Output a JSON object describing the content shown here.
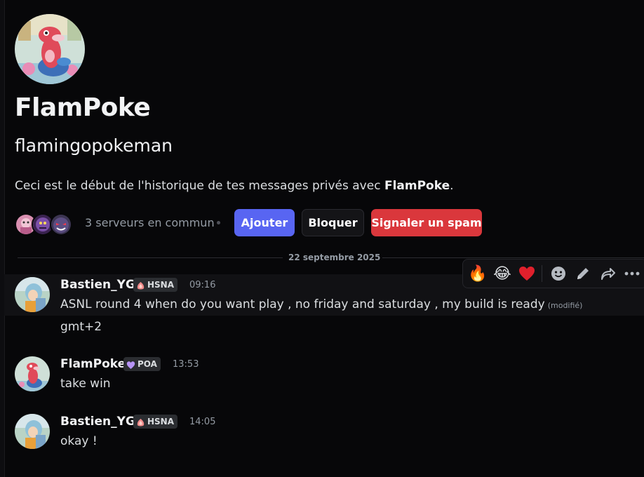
{
  "profile": {
    "display_name": "FlamPoke",
    "username": "flamingopokeman",
    "intro_prefix": "Ceci est le début de l'historique de tes messages privés avec ",
    "intro_name": "FlamPoke",
    "intro_suffix": "."
  },
  "mutual": {
    "servers_text": "3 serveurs en commun"
  },
  "actions": {
    "add_label": "Ajouter",
    "block_label": "Bloquer",
    "spam_label": "Signaler un spam"
  },
  "date_separator": "22 septembre 2025",
  "toolbar": {
    "reactions": [
      "🔥",
      "😂",
      "❤️"
    ],
    "icons": [
      "add-reaction-icon",
      "edit-icon",
      "forward-icon",
      "more-icon"
    ]
  },
  "messages": [
    {
      "author": "Bastien_YG",
      "tag": "HSNA",
      "time": "09:16",
      "lines": [
        "ASNL round 4 when do you want play , no friday and saturday , my build is ready"
      ],
      "edited": "(modifié)",
      "followup": "gmt+2"
    },
    {
      "author": "FlamPoke",
      "tag": "POA",
      "time": "13:53",
      "lines": [
        "take win"
      ]
    },
    {
      "author": "Bastien_YG",
      "tag": "HSNA",
      "time": "14:05",
      "lines": [
        "okay !"
      ]
    }
  ],
  "colors": {
    "background": "#070709",
    "blurple": "#5865f2",
    "danger": "#da373c"
  }
}
